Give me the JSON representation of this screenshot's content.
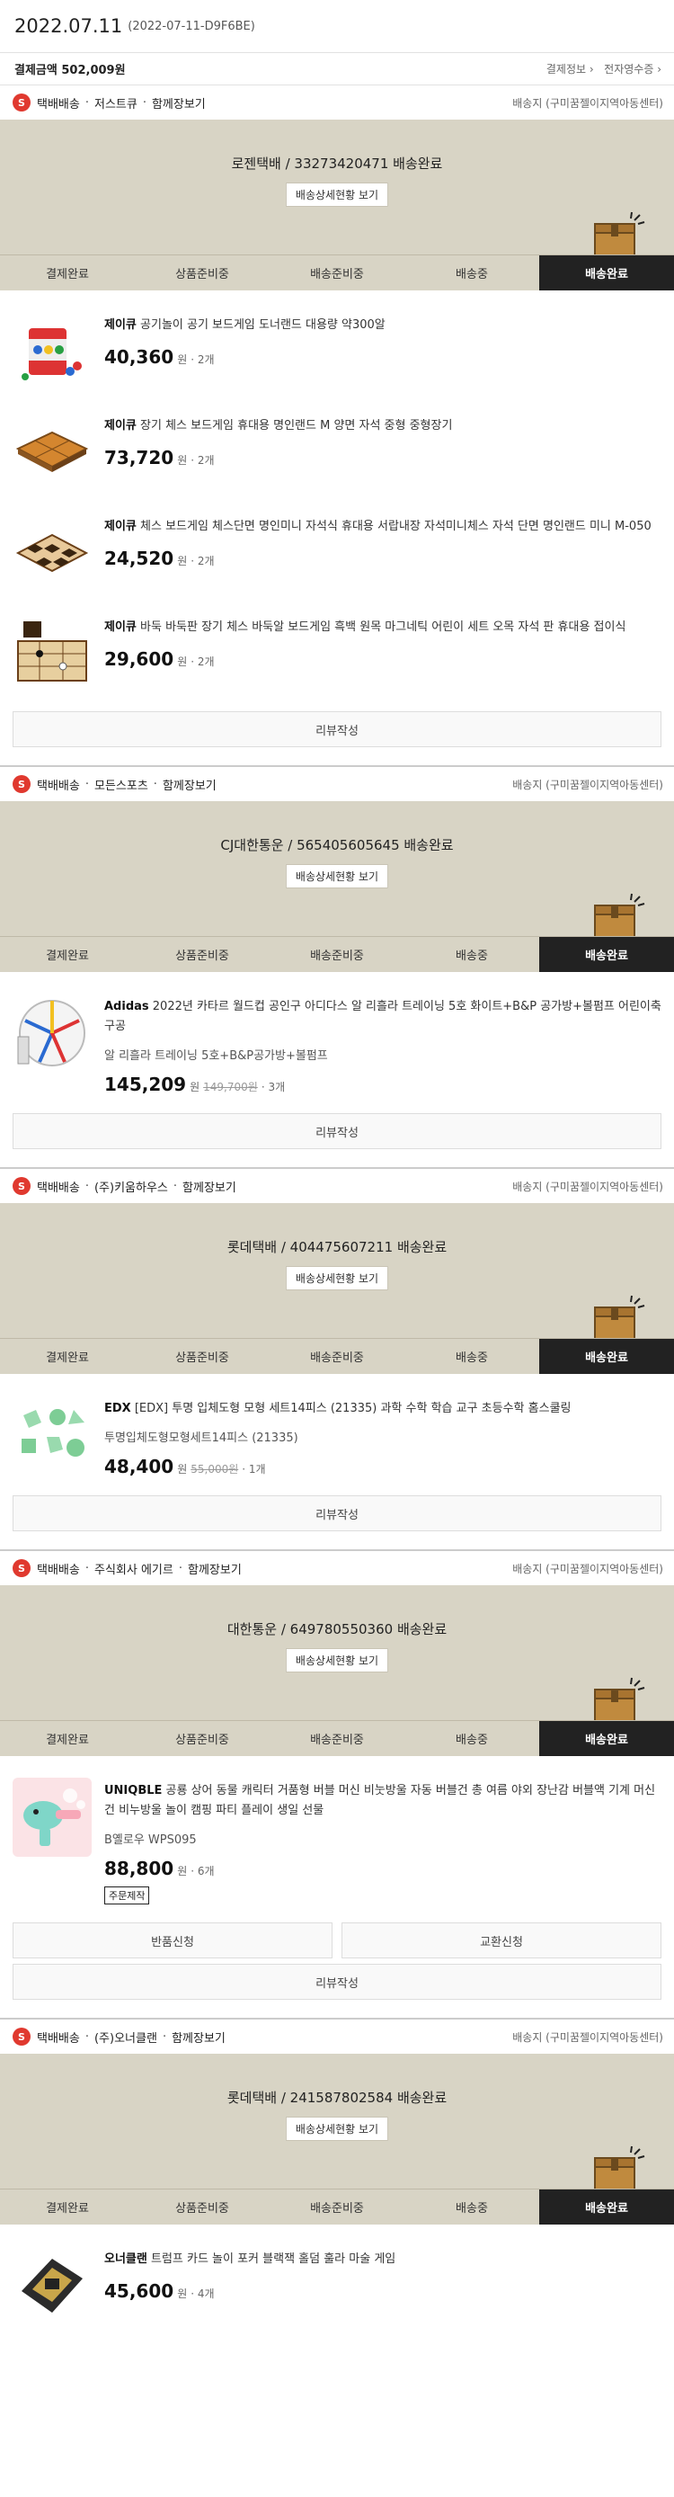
{
  "order": {
    "date": "2022.07.11",
    "id": "(2022-07-11-D9F6BE)",
    "payment_label": "결제금액",
    "payment_amount": "502,009원",
    "pay_info_link": "결제정보",
    "receipt_link": "전자영수증",
    "link_arrow": "›"
  },
  "labels": {
    "delivery_type": "택배배송",
    "dot": "·",
    "combine_view": "함께장보기",
    "detail_button": "배송상세현황 보기",
    "review_button": "리뷰작성",
    "return_button": "반품신청",
    "exchange_button": "교환신청",
    "unit_won": "원",
    "s_badge": "S"
  },
  "steps": [
    "결제완료",
    "상품준비중",
    "배송준비중",
    "배송중",
    "배송완료"
  ],
  "sections": [
    {
      "seller": "저스트큐",
      "show_combine": true,
      "ship_to": "배송지 (구미꿈젤이지역아동센터)",
      "status": "로젠택배 / 33273420471 배송완료",
      "products": [
        {
          "brand": "제이큐",
          "name": "공기놀이 공기 보드게임 도너랜드 대용량 약300알",
          "price": "40,360",
          "qty": "· 2개"
        },
        {
          "brand": "제이큐",
          "name": "장기 체스 보드게임 휴대용 명인랜드 M 양면 자석 중형 중형장기",
          "price": "73,720",
          "qty": "· 2개"
        },
        {
          "brand": "제이큐",
          "name": "체스 보드게임 체스단면 명인미니 자석식 휴대용 서랍내장 자석미니체스 자석 단면 명인랜드 미니 M-050",
          "price": "24,520",
          "qty": "· 2개"
        },
        {
          "brand": "제이큐",
          "name": "바둑 바둑판 장기 체스 바둑알 보드게임 흑백 원목 마그네틱 어린이 세트 오목 자석 판 휴대용 접이식",
          "price": "29,600",
          "qty": "· 2개"
        }
      ]
    },
    {
      "seller": "모든스포츠",
      "show_combine": true,
      "ship_to": "배송지 (구미꿈젤이지역아동센터)",
      "status": "CJ대한통운 / 565405605645 배송완료",
      "products": [
        {
          "brand": "Adidas",
          "name": "2022년 카타르 월드컵 공인구 아디다스 알 리흘라 트레이닝 5호 화이트+B&P 공가방+볼펌프 어린이축구공",
          "option": "알 리흘라 트레이닝 5호+B&P공가방+볼펌프",
          "price": "145,209",
          "orig": "149,700원",
          "qty": "· 3개"
        }
      ]
    },
    {
      "seller": "(주)키움하우스",
      "show_combine": true,
      "ship_to": "배송지 (구미꿈젤이지역아동센터)",
      "status": "롯데택배 / 404475607211 배송완료",
      "products": [
        {
          "brand": "EDX",
          "name": "[EDX] 투명 입체도형 모형 세트14피스 (21335) 과학 수학 학습 교구 초등수학 홈스쿨링",
          "option": "투명입체도형모형세트14피스 (21335)",
          "price": "48,400",
          "orig": "55,000원",
          "qty": "· 1개"
        }
      ]
    },
    {
      "seller": "주식회사 에기르",
      "show_combine": true,
      "ship_to": "배송지 (구미꿈젤이지역아동센터)",
      "status": "대한통운 / 649780550360 배송완료",
      "products": [
        {
          "brand": "UNIQBLE",
          "name": "공룡 상어 동물 캐릭터 거품형 버블 머신 비눗방울 자동 버블건 총 여름 야외 장난감 버블액 기계 머신건 비누방울 놀이 캠핑 파티 플레이 생일 선물",
          "option": "B옐로우 WPS095",
          "price": "88,800",
          "qty": "· 6개",
          "badge": "주문제작"
        }
      ]
    },
    {
      "seller": "(주)오너클랜",
      "show_combine": true,
      "ship_to": "배송지 (구미꿈젤이지역아동센터)",
      "status": "롯데택배 / 241587802584 배송완료",
      "products": [
        {
          "brand": "오너클랜",
          "name": "트럼프 카드 놀이 포커 블랙잭 홀덤 훌라 마술 게임",
          "price": "45,600",
          "qty": "· 4개"
        }
      ]
    }
  ],
  "colors": {
    "status_bg": "#d8d4c5",
    "active_step_bg": "#222222",
    "badge_red": "#e0392f"
  }
}
